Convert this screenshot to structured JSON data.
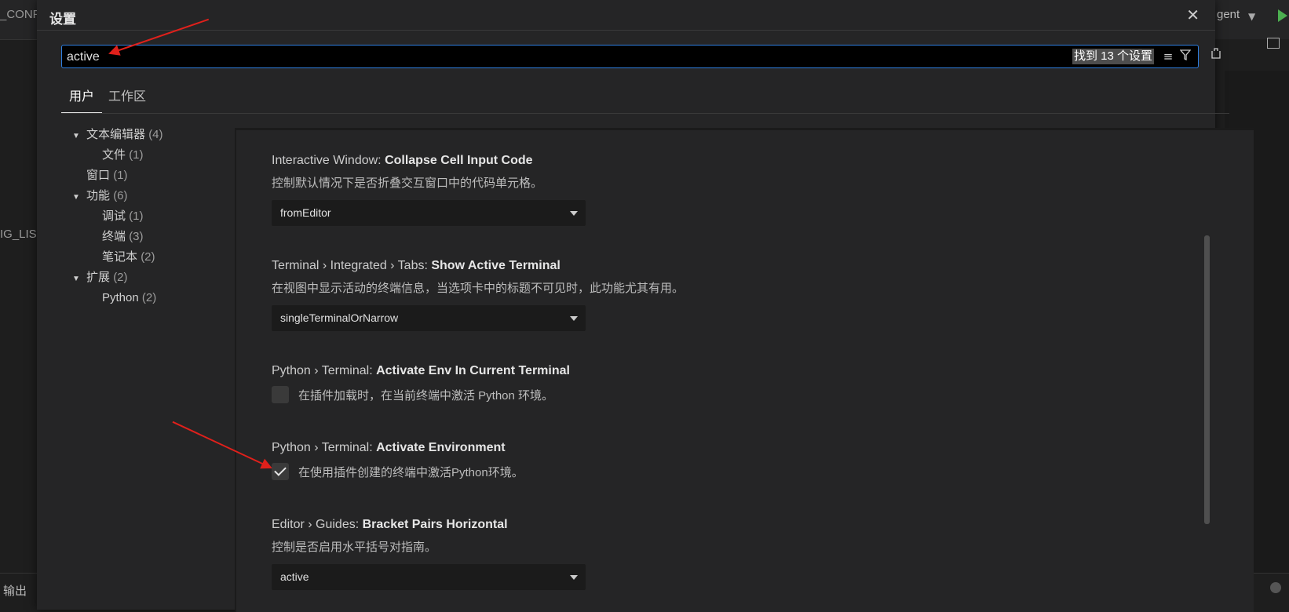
{
  "background": {
    "left_top_text": "_CONF",
    "left_mid_text": "IG_LIS",
    "bottom_left_text": "输出",
    "right_top_text": "gent"
  },
  "dialog": {
    "title": "设置",
    "close_symbol": "✕"
  },
  "search": {
    "value": "active",
    "result_count": "找到 13 个设置"
  },
  "tabs": [
    {
      "label": "用户",
      "active": true
    },
    {
      "label": "工作区",
      "active": false
    }
  ],
  "toc": {
    "items": [
      {
        "label": "文本编辑器",
        "count": "(4)"
      },
      {
        "label": "文件",
        "count": "(1)"
      },
      {
        "label": "窗口",
        "count": "(1)"
      },
      {
        "label": "功能",
        "count": "(6)"
      },
      {
        "label": "调试",
        "count": "(1)"
      },
      {
        "label": "终端",
        "count": "(3)"
      },
      {
        "label": "笔记本",
        "count": "(2)"
      },
      {
        "label": "扩展",
        "count": "(2)"
      },
      {
        "label": "Python",
        "count": "(2)"
      }
    ]
  },
  "settings": [
    {
      "category": "Interactive Window: ",
      "name": "Collapse Cell Input Code",
      "description": "控制默认情况下是否折叠交互窗口中的代码单元格。",
      "value": "fromEditor"
    },
    {
      "category": "Terminal › Integrated › Tabs: ",
      "name": "Show Active Terminal",
      "description": "在视图中显示活动的终端信息，当选项卡中的标题不可见时，此功能尤其有用。",
      "value": "singleTerminalOrNarrow"
    },
    {
      "category": "Python › Terminal: ",
      "name": "Activate Env In Current Terminal",
      "checkbox_label": "在插件加载时，在当前终端中激活 Python 环境。",
      "checked": false
    },
    {
      "category": "Python › Terminal: ",
      "name": "Activate Environment",
      "checkbox_label": "在使用插件创建的终端中激活Python环境。",
      "checked": true
    },
    {
      "category": "Editor › Guides: ",
      "name": "Bracket Pairs Horizontal",
      "description": "控制是否启用水平括号对指南。",
      "value": "active"
    }
  ],
  "colors": {
    "accent": "#2f7fe0",
    "annotation": "#e0201b",
    "dialog_bg": "#252526"
  }
}
